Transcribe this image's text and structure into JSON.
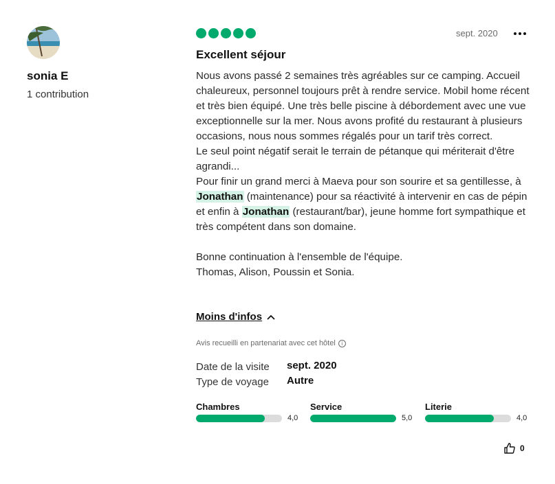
{
  "user": {
    "name": "sonia E",
    "contributions": "1 contribution"
  },
  "review": {
    "bubble_rating": 5,
    "bubble_max": 5,
    "date": "sept. 2020",
    "title": "Excellent séjour",
    "paragraphs": {
      "p1": "Nous avons passé 2 semaines très agréables sur ce camping. Accueil chaleureux, personnel toujours prêt à rendre service. Mobil home récent et très bien équipé. Une très belle piscine à débordement avec une vue exceptionnelle sur la mer. Nous avons profité du restaurant à plusieurs occasions, nous nous sommes régalés pour un tarif très correct.",
      "p2": "Le seul point négatif serait le terrain de pétanque qui mériterait d'être agrandi...",
      "p3_a": "Pour finir un grand merci à Maeva pour son sourire et sa gentillesse, à ",
      "p3_name1": "Jonathan",
      "p3_b": " (maintenance) pour sa réactivité à intervenir en cas de pépin et enfin à ",
      "p3_name2": "Jonathan",
      "p3_c": " (restaurant/bar), jeune homme fort sympathique et très compétent dans son domaine.",
      "p4": "Bonne continuation à l'ensemble de l'équipe.",
      "p5": "Thomas, Alison, Poussin et Sonia."
    },
    "less_label": "Moins d'infos",
    "partner_note": "Avis recueilli en partenariat avec cet hôtel",
    "visit_date_label": "Date de la visite",
    "visit_date_value": "sept. 2020",
    "trip_type_label": "Type de voyage",
    "trip_type_value": "Autre",
    "sub_ratings": [
      {
        "label": "Chambres",
        "value": "4,0",
        "score": 4.0
      },
      {
        "label": "Service",
        "value": "5,0",
        "score": 5.0
      },
      {
        "label": "Literie",
        "value": "4,0",
        "score": 4.0
      }
    ],
    "helpful_count": "0"
  },
  "colors": {
    "accent": "#00aa6c",
    "highlight": "#d5f2e6",
    "track": "#dcdcdc"
  },
  "icons": [
    "more-options-icon",
    "chevron-up-icon",
    "info-icon",
    "thumbs-up-icon"
  ]
}
